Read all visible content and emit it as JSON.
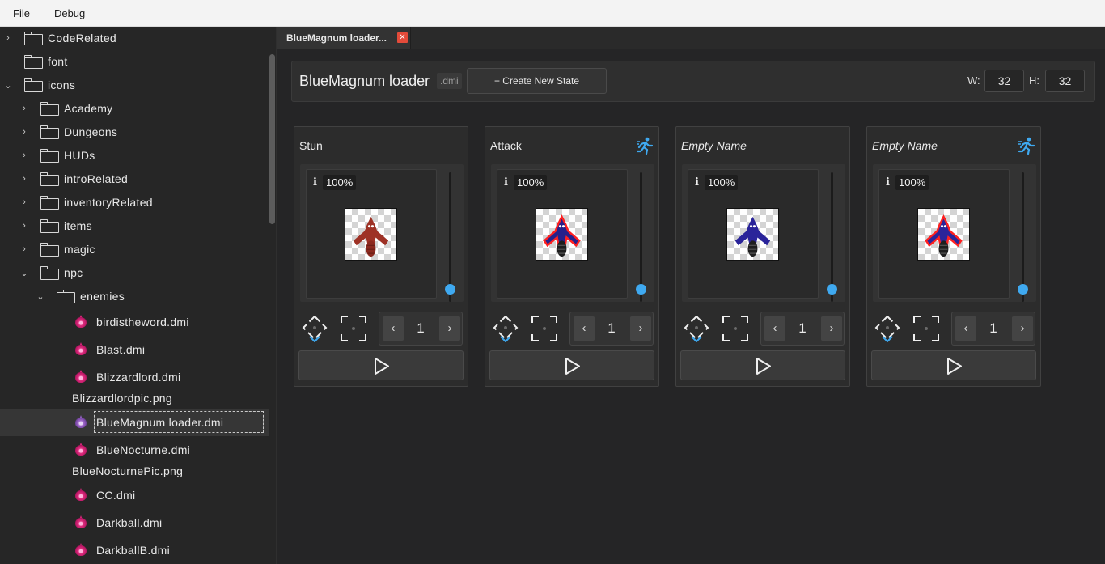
{
  "menu": {
    "file": "File",
    "debug": "Debug"
  },
  "tree": [
    {
      "label": "CodeRelated",
      "type": "folder",
      "chevron": "›"
    },
    {
      "label": "font",
      "type": "folder",
      "chevron": ""
    },
    {
      "label": "icons",
      "type": "folder",
      "chevron": "⌄"
    },
    {
      "label": "Academy",
      "type": "folder",
      "chevron": "›"
    },
    {
      "label": "Dungeons",
      "type": "folder",
      "chevron": "›"
    },
    {
      "label": "HUDs",
      "type": "folder",
      "chevron": "›"
    },
    {
      "label": "introRelated",
      "type": "folder",
      "chevron": "›"
    },
    {
      "label": "inventoryRelated",
      "type": "folder",
      "chevron": "›"
    },
    {
      "label": "items",
      "type": "folder",
      "chevron": "›"
    },
    {
      "label": "magic",
      "type": "folder",
      "chevron": "›"
    },
    {
      "label": "npc",
      "type": "folder",
      "chevron": "⌄"
    },
    {
      "label": "enemies",
      "type": "folder",
      "chevron": "⌄"
    },
    {
      "label": "birdistheword.dmi",
      "type": "dmi"
    },
    {
      "label": "Blast.dmi",
      "type": "dmi"
    },
    {
      "label": "Blizzardlord.dmi",
      "type": "dmi"
    },
    {
      "label": "Blizzardlordpic.png",
      "type": "png"
    },
    {
      "label": "BlueMagnum loader.dmi",
      "type": "dmi",
      "selected": true
    },
    {
      "label": "BlueNocturne.dmi",
      "type": "dmi"
    },
    {
      "label": "BlueNocturnePic.png",
      "type": "png"
    },
    {
      "label": "CC.dmi",
      "type": "dmi"
    },
    {
      "label": "Darkball.dmi",
      "type": "dmi"
    },
    {
      "label": "DarkballB.dmi",
      "type": "dmi"
    }
  ],
  "tab": {
    "title": "BlueMagnum loader...",
    "close": "✕"
  },
  "header": {
    "title": "BlueMagnum loader",
    "ext": ".dmi",
    "create_button": "+ Create New State",
    "w_label": "W:",
    "w_value": "32",
    "h_label": "H:",
    "h_value": "32"
  },
  "states": [
    {
      "name": "Stun",
      "italic": false,
      "movement": false,
      "zoom": "100%",
      "frame": "1",
      "sprite_color": "#9e3226"
    },
    {
      "name": "Attack",
      "italic": false,
      "movement": true,
      "zoom": "100%",
      "frame": "1",
      "sprite_color": "#26208a"
    },
    {
      "name": "Empty Name",
      "italic": true,
      "movement": false,
      "zoom": "100%",
      "frame": "1",
      "sprite_color": "#2a249a"
    },
    {
      "name": "Empty Name",
      "italic": true,
      "movement": true,
      "zoom": "100%",
      "frame": "1",
      "sprite_color": "#2a249a"
    }
  ],
  "colors": {
    "accent": "#3fa9f0",
    "close": "#e44b3a",
    "dmi_gem": "#d6237a"
  },
  "icons": {
    "info": "i",
    "prev": "‹",
    "next": "›"
  }
}
